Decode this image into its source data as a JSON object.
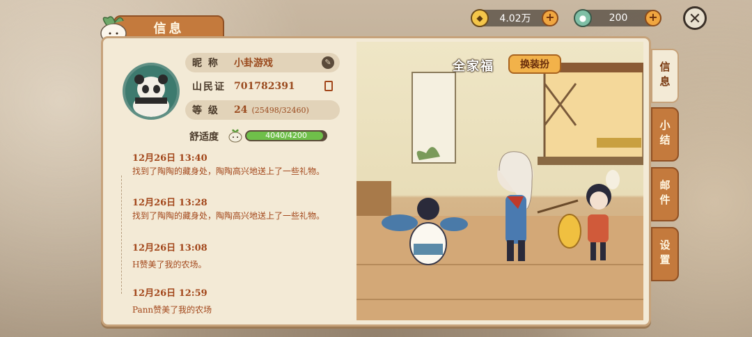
{
  "header": {
    "tab_title": "信息",
    "currency_gold": "4.02万",
    "currency_coin": "200"
  },
  "profile": {
    "nickname_label": "昵 称",
    "nickname": "小卦游戏",
    "id_label": "山民证",
    "id_value": "701782391",
    "level_label": "等 级",
    "level": "24",
    "level_exp": "(25498/32460)",
    "comfort_label": "舒适度",
    "comfort_value": "4040/4200",
    "comfort_progress": 0.962
  },
  "log": [
    {
      "time": "12月26日 13:40",
      "text": "找到了陶陶的藏身处，陶陶高兴地送上了一些礼物。"
    },
    {
      "time": "12月26日 13:28",
      "text": "找到了陶陶的藏身处，陶陶高兴地送上了一些礼物。"
    },
    {
      "time": "12月26日 13:08",
      "text": "H赞美了我的农场。"
    },
    {
      "time": "12月26日 12:59",
      "text": "Pann赞美了我的农场"
    }
  ],
  "scene": {
    "title": "全家福",
    "dress_button": "换装扮"
  },
  "side_tabs": [
    "信息",
    "小结",
    "邮件",
    "设置"
  ],
  "colors": {
    "accent": "#c47a3d",
    "panel": "#f3ead6",
    "text_red": "#a2461a",
    "progress": "#6fbf4a"
  }
}
